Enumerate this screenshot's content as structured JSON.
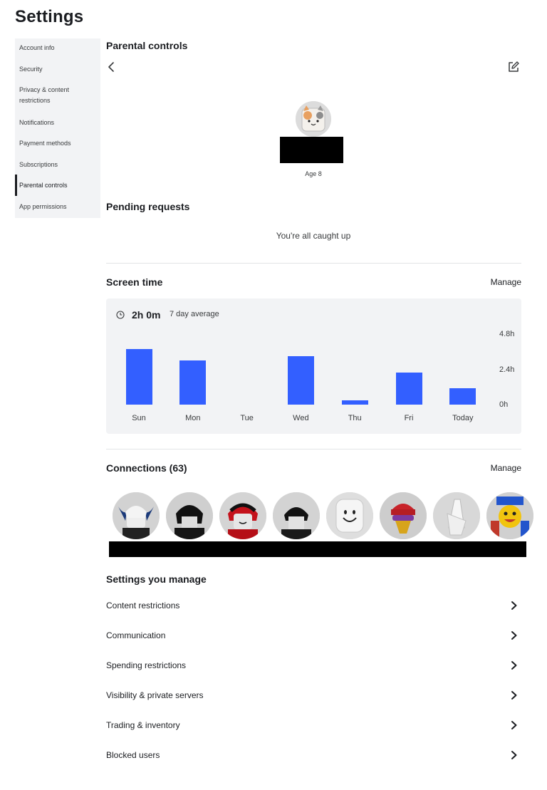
{
  "page": {
    "title": "Settings"
  },
  "sidebar": {
    "items": [
      {
        "label": "Account info"
      },
      {
        "label": "Security"
      },
      {
        "label": "Privacy & content"
      },
      {
        "label": "restrictions"
      },
      {
        "label": "Notifications"
      },
      {
        "label": "Payment methods"
      },
      {
        "label": "Subscriptions"
      },
      {
        "label": "Parental controls",
        "active": true
      },
      {
        "label": "App permissions"
      }
    ]
  },
  "parental": {
    "title": "Parental controls",
    "child": {
      "age": "Age 8",
      "avatar_icon": "cat-avatar"
    }
  },
  "pending": {
    "title": "Pending requests",
    "empty_text": "You're all caught up"
  },
  "screen_time": {
    "title": "Screen time",
    "manage_label": "Manage",
    "total": "2h 0m",
    "caption": "7 day average",
    "clock_icon": "clock-icon",
    "accent": "#335fff",
    "y_ticks": [
      "4.8h",
      "2.4h",
      "0h"
    ]
  },
  "chart_data": {
    "type": "bar",
    "categories": [
      "Sun",
      "Mon",
      "Tue",
      "Wed",
      "Thu",
      "Fri",
      "Today"
    ],
    "values": [
      3.8,
      3.0,
      0,
      3.3,
      0.3,
      2.2,
      1.1
    ],
    "ylim": [
      0,
      4.8
    ],
    "ylabel": "",
    "xlabel": "",
    "title": ""
  },
  "connections": {
    "title": "Connections (63)",
    "manage_label": "Manage"
  },
  "settings_manage": {
    "title": "Settings you manage",
    "items": [
      {
        "label": "Content restrictions"
      },
      {
        "label": "Communication"
      },
      {
        "label": "Spending restrictions"
      },
      {
        "label": "Visibility & private servers"
      },
      {
        "label": "Trading & inventory"
      },
      {
        "label": "Blocked users"
      }
    ]
  }
}
